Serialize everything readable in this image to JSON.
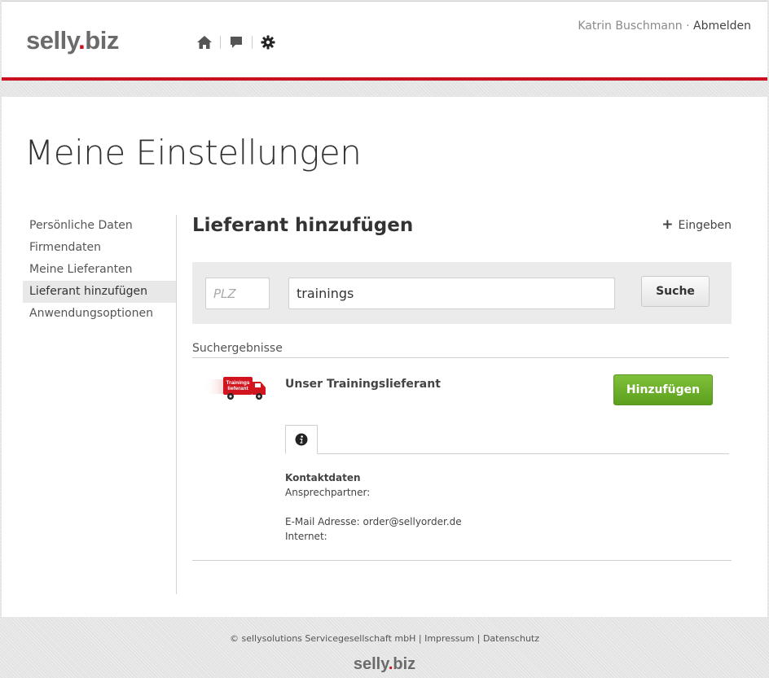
{
  "header": {
    "logo_left": "selly",
    "logo_dot": ".",
    "logo_right": "biz",
    "icons": [
      "home-icon",
      "chat-icon",
      "gear-icon"
    ],
    "user_name": "Katrin Buschmann",
    "separator": "·",
    "logout_label": "Abmelden"
  },
  "page": {
    "title": "Meine Einstellungen"
  },
  "sidebar": {
    "items": [
      {
        "label": "Persönliche Daten"
      },
      {
        "label": "Firmendaten"
      },
      {
        "label": "Meine Lieferanten"
      },
      {
        "label": "Lieferant hinzufügen",
        "active": true
      },
      {
        "label": "Anwendungsoptionen"
      }
    ]
  },
  "content": {
    "section_title": "Lieferant hinzufügen",
    "enter_link": "Eingeben",
    "search": {
      "plz_placeholder": "PLZ",
      "plz_value": "",
      "query_value": "trainings",
      "button_label": "Suche"
    },
    "results_label": "Suchergebnisse",
    "result": {
      "supplier_name": "Unser Trainingslieferant",
      "truck_text": "Trainings lieferant",
      "add_button": "Hinzufügen",
      "contact_heading": "Kontaktdaten",
      "contact_person_label": "Ansprechpartner:",
      "email_line": "E-Mail Adresse: order@sellyorder.de",
      "internet_label": "Internet:"
    }
  },
  "footer": {
    "copyright": "© sellysolutions Servicegesellschaft mbH",
    "sep": "|",
    "impressum": "Impressum",
    "datenschutz": "Datenschutz"
  },
  "colors": {
    "brand_red": "#c8101e",
    "add_green": "#6cb02a",
    "logo_gray": "#6b6b6b"
  }
}
